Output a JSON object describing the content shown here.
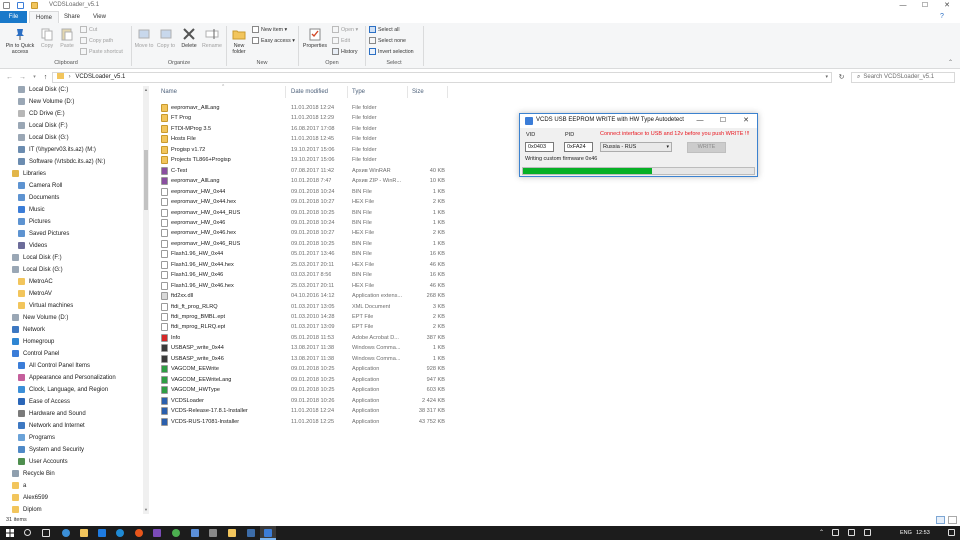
{
  "window": {
    "title": "VCDSLoader_v5.1",
    "minimize": "—",
    "maximize": "☐",
    "close": "✕"
  },
  "tabs": [
    "File",
    "Home",
    "Share",
    "View"
  ],
  "ribbon": {
    "clipboard": {
      "pin": "Pin to Quick access",
      "copy": "Copy",
      "paste": "Paste",
      "cut": "Cut",
      "copy_path": "Copy path",
      "paste_shortcut": "Paste shortcut",
      "label": "Clipboard"
    },
    "organize": {
      "move_to": "Move to",
      "copy_to": "Copy to",
      "delete": "Delete",
      "rename": "Rename",
      "label": "Organize"
    },
    "new": {
      "new_folder": "New folder",
      "new_item": "New item",
      "easy_access": "Easy access",
      "label": "New"
    },
    "open": {
      "properties": "Properties",
      "open": "Open",
      "edit": "Edit",
      "history": "History",
      "label": "Open"
    },
    "select": {
      "select_all": "Select all",
      "select_none": "Select none",
      "invert": "Invert selection",
      "label": "Select"
    }
  },
  "address": {
    "path": "VCDSLoader_v5.1",
    "search_placeholder": "Search VCDSLoader_v5.1"
  },
  "nav": [
    {
      "label": "Local Disk (C:)",
      "icon": "drive-icon",
      "indent": 1
    },
    {
      "label": "New Volume (D:)",
      "icon": "drive-icon",
      "indent": 1
    },
    {
      "label": "CD Drive (E:)",
      "icon": "cd-icon",
      "indent": 1
    },
    {
      "label": "Local Disk (F:)",
      "icon": "drive-icon",
      "indent": 1
    },
    {
      "label": "Local Disk (G:)",
      "icon": "drive-icon",
      "indent": 1
    },
    {
      "label": "IT (\\\\hyperv03.its.az) (M:)",
      "icon": "network-drive-icon",
      "indent": 1
    },
    {
      "label": "Software (\\\\rtsbdc.its.az) (N:)",
      "icon": "network-drive-icon",
      "indent": 1
    },
    {
      "label": "Libraries",
      "icon": "libraries-icon",
      "indent": 0
    },
    {
      "label": "Camera Roll",
      "icon": "library-icon",
      "indent": 1
    },
    {
      "label": "Documents",
      "icon": "library-icon",
      "indent": 1
    },
    {
      "label": "Music",
      "icon": "music-icon",
      "indent": 1
    },
    {
      "label": "Pictures",
      "icon": "library-icon",
      "indent": 1
    },
    {
      "label": "Saved Pictures",
      "icon": "library-icon",
      "indent": 1
    },
    {
      "label": "Videos",
      "icon": "video-icon",
      "indent": 1
    },
    {
      "label": "Local Disk (F:)",
      "icon": "drive-icon",
      "indent": 0
    },
    {
      "label": "Local Disk (G:)",
      "icon": "drive-icon",
      "indent": 0
    },
    {
      "label": "MetroAC",
      "icon": "folder-icon",
      "indent": 1
    },
    {
      "label": "MetroAV",
      "icon": "folder-icon",
      "indent": 1
    },
    {
      "label": "Virtual machines",
      "icon": "folder-icon",
      "indent": 1
    },
    {
      "label": "New Volume (D:)",
      "icon": "drive-icon",
      "indent": 0
    },
    {
      "label": "Network",
      "icon": "network-icon",
      "indent": 0
    },
    {
      "label": "Homegroup",
      "icon": "homegroup-icon",
      "indent": 0
    },
    {
      "label": "Control Panel",
      "icon": "control-panel-icon",
      "indent": 0
    },
    {
      "label": "All Control Panel Items",
      "icon": "control-panel-icon",
      "indent": 1
    },
    {
      "label": "Appearance and Personalization",
      "icon": "appearance-icon",
      "indent": 1
    },
    {
      "label": "Clock, Language, and Region",
      "icon": "clock-icon",
      "indent": 1
    },
    {
      "label": "Ease of Access",
      "icon": "ease-icon",
      "indent": 1
    },
    {
      "label": "Hardware and Sound",
      "icon": "hardware-icon",
      "indent": 1
    },
    {
      "label": "Network and Internet",
      "icon": "network-icon",
      "indent": 1
    },
    {
      "label": "Programs",
      "icon": "programs-icon",
      "indent": 1
    },
    {
      "label": "System and Security",
      "icon": "security-icon",
      "indent": 1
    },
    {
      "label": "User Accounts",
      "icon": "user-icon",
      "indent": 1
    },
    {
      "label": "Recycle Bin",
      "icon": "recycle-icon",
      "indent": 0
    },
    {
      "label": "a",
      "icon": "folder-icon",
      "indent": 0
    },
    {
      "label": "Alex6599",
      "icon": "folder-icon",
      "indent": 0
    },
    {
      "label": "Diplom",
      "icon": "folder-icon",
      "indent": 0
    }
  ],
  "columns": {
    "name": "Name",
    "date": "Date modified",
    "type": "Type",
    "size": "Size"
  },
  "files": [
    {
      "name": "eepromavr_AllLang",
      "date": "11.01.2018 12:24",
      "type": "File folder",
      "size": "",
      "kind": "folder"
    },
    {
      "name": "FT Prog",
      "date": "11.01.2018 12:29",
      "type": "File folder",
      "size": "",
      "kind": "folder"
    },
    {
      "name": "FTDI-MProg 3.5",
      "date": "16.08.2017 17:08",
      "type": "File folder",
      "size": "",
      "kind": "folder"
    },
    {
      "name": "Hosts File",
      "date": "11.01.2018 12:45",
      "type": "File folder",
      "size": "",
      "kind": "folder"
    },
    {
      "name": "Progisp v1.72",
      "date": "19.10.2017 15:06",
      "type": "File folder",
      "size": "",
      "kind": "folder"
    },
    {
      "name": "Projects TL866+Progisp",
      "date": "19.10.2017 15:06",
      "type": "File folder",
      "size": "",
      "kind": "folder"
    },
    {
      "name": "C-Test",
      "date": "07.08.2017 11:42",
      "type": "Архив WinRAR",
      "size": "40 KB",
      "kind": "rar"
    },
    {
      "name": "eepromavr_AllLang",
      "date": "10.01.2018 7:47",
      "type": "Архив ZIP - WinR...",
      "size": "10 KB",
      "kind": "zip"
    },
    {
      "name": "eepromavr_HW_0x44",
      "date": "09.01.2018 10:24",
      "type": "BIN File",
      "size": "1 KB",
      "kind": "bin"
    },
    {
      "name": "eepromavr_HW_0x44.hex",
      "date": "09.01.2018 10:27",
      "type": "HEX File",
      "size": "2 KB",
      "kind": "hex"
    },
    {
      "name": "eepromavr_HW_0x44_RUS",
      "date": "09.01.2018 10:25",
      "type": "BIN File",
      "size": "1 KB",
      "kind": "bin"
    },
    {
      "name": "eepromavr_HW_0x46",
      "date": "09.01.2018 10:24",
      "type": "BIN File",
      "size": "1 KB",
      "kind": "bin"
    },
    {
      "name": "eepromavr_HW_0x46.hex",
      "date": "09.01.2018 10:27",
      "type": "HEX File",
      "size": "2 KB",
      "kind": "hex"
    },
    {
      "name": "eepromavr_HW_0x46_RUS",
      "date": "09.01.2018 10:25",
      "type": "BIN File",
      "size": "1 KB",
      "kind": "bin"
    },
    {
      "name": "Flash1.96_HW_0x44",
      "date": "05.01.2017 13:46",
      "type": "BIN File",
      "size": "16 KB",
      "kind": "bin"
    },
    {
      "name": "Flash1.96_HW_0x44.hex",
      "date": "25.03.2017 20:11",
      "type": "HEX File",
      "size": "46 KB",
      "kind": "hex"
    },
    {
      "name": "Flash1.96_HW_0x46",
      "date": "03.03.2017 8:56",
      "type": "BIN File",
      "size": "16 KB",
      "kind": "bin"
    },
    {
      "name": "Flash1.96_HW_0x46.hex",
      "date": "25.03.2017 20:11",
      "type": "HEX File",
      "size": "46 KB",
      "kind": "hex"
    },
    {
      "name": "ftd2xx.dll",
      "date": "04.10.2016 14:12",
      "type": "Application extens...",
      "size": "268 KB",
      "kind": "dll"
    },
    {
      "name": "ftdi_ft_prog_RLRQ",
      "date": "01.03.2017 13:05",
      "type": "XML Document",
      "size": "3 KB",
      "kind": "xml"
    },
    {
      "name": "ftdi_mprog_BMBL.ept",
      "date": "01.03.2010 14:28",
      "type": "EPT File",
      "size": "2 KB",
      "kind": "ept"
    },
    {
      "name": "ftdi_mprog_RLRQ.ept",
      "date": "01.03.2017 13:09",
      "type": "EPT File",
      "size": "2 KB",
      "kind": "ept"
    },
    {
      "name": "Info",
      "date": "05.01.2018 11:53",
      "type": "Adobe Acrobat D...",
      "size": "387 KB",
      "kind": "pdf"
    },
    {
      "name": "USBASP_write_0x44",
      "date": "13.08.2017 11:38",
      "type": "Windows Comma...",
      "size": "1 KB",
      "kind": "cmd"
    },
    {
      "name": "USBASP_write_0x46",
      "date": "13.08.2017 11:38",
      "type": "Windows Comma...",
      "size": "1 KB",
      "kind": "cmd"
    },
    {
      "name": "VAGCOM_EEWrite",
      "date": "09.01.2018 10:25",
      "type": "Application",
      "size": "928 KB",
      "kind": "app"
    },
    {
      "name": "VAGCOM_EEWriteLang",
      "date": "09.01.2018 10:25",
      "type": "Application",
      "size": "947 KB",
      "kind": "app"
    },
    {
      "name": "VAGCOM_HWType",
      "date": "09.01.2018 10:25",
      "type": "Application",
      "size": "603 KB",
      "kind": "app"
    },
    {
      "name": "VCDSLoader",
      "date": "09.01.2018 10:26",
      "type": "Application",
      "size": "2 424 KB",
      "kind": "vcds"
    },
    {
      "name": "VCDS-Release-17.8.1-Installer",
      "date": "11.01.2018 12:24",
      "type": "Application",
      "size": "38 317 KB",
      "kind": "vcds"
    },
    {
      "name": "VCDS-RUS-17081-Installer",
      "date": "11.01.2018 12:25",
      "type": "Application",
      "size": "43 752 KB",
      "kind": "vcds"
    }
  ],
  "status": {
    "count": "31 items"
  },
  "dialog": {
    "title": "VCDS USB EEPROM WRITE with HW Type Autodetect",
    "vid_label": "VID",
    "pid_label": "PID",
    "vid_value": "0x0403",
    "pid_value": "0xFA24",
    "warning": "Connect interface to USB and 12v before you push WRITE !!!",
    "language": "Russia - RUS",
    "write_button": "WRITE",
    "status_text": "Writing custom firmware 0x46",
    "progress": 0.56,
    "warning_color": "#e8141c",
    "progress_color": "#06b025"
  },
  "taskbar": {
    "language": "ENG",
    "time": "12:53"
  }
}
